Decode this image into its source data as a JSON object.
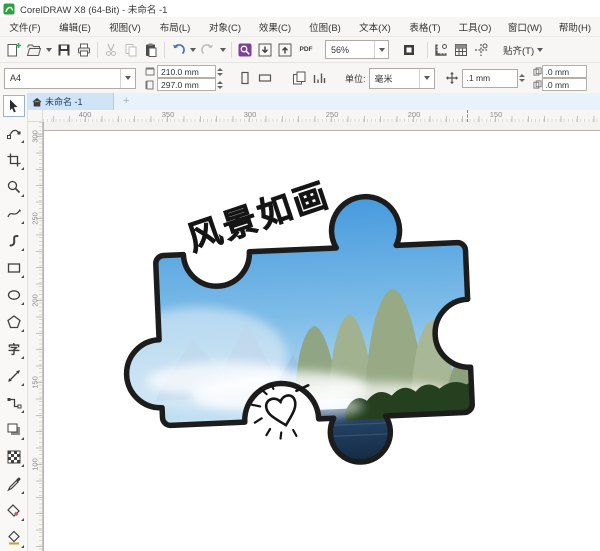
{
  "titlebar": {
    "title": "CorelDRAW X8 (64-Bit) - 未命名 -1"
  },
  "menubar": {
    "items": [
      "文件(F)",
      "编辑(E)",
      "视图(V)",
      "布局(L)",
      "对象(C)",
      "效果(C)",
      "位图(B)",
      "文本(X)",
      "表格(T)",
      "工具(O)",
      "窗口(W)",
      "帮助(H)"
    ]
  },
  "toolbar": {
    "zoom_level": "56%",
    "pdf_label": "PDF",
    "snap_label": "贴齐(T)",
    "icons": [
      "new-document",
      "open",
      "save",
      "print",
      "cut",
      "copy",
      "paste",
      "undo",
      "redo",
      "search-content",
      "import",
      "export",
      "publish-pdf",
      "fullscreen-preview",
      "show-rulers",
      "show-grid",
      "show-guidelines"
    ]
  },
  "property_bar": {
    "page_preset": "A4",
    "page_width": "210.0 mm",
    "page_height": "297.0 mm",
    "units_label": "单位:",
    "units_value": "毫米",
    "nudge_distance": ".1 mm",
    "duplicate_x": ".0 mm",
    "duplicate_y": ".0 mm"
  },
  "document_tab": {
    "label": "未命名 -1",
    "new_page_label": "+"
  },
  "rulers": {
    "horizontal": [
      "400",
      "350",
      "300",
      "250",
      "200",
      "150"
    ],
    "vertical": [
      "300",
      "250",
      "200",
      "150",
      "100"
    ]
  },
  "toolbox": {
    "text_tool_glyph": "字",
    "tools": [
      "选择工具",
      "形状工具",
      "裁剪工具",
      "缩放工具",
      "手绘工具",
      "艺术笔工具",
      "矩形工具",
      "椭圆形工具",
      "多边形工具",
      "文本工具",
      "平行度量工具",
      "连接器工具",
      "阴影工具",
      "透明度工具",
      "颜色滴管工具",
      "交互式填充工具",
      "智能填充工具"
    ]
  },
  "canvas": {
    "artwork_title": "风景如画"
  },
  "colors": {
    "accent_purple": "#7d3f98",
    "tab_blue": "#cfe4f6",
    "sky_top": "#3e95dc",
    "sky_bottom": "#ddeef8",
    "mountain": "#98ab86",
    "trees": "#24401e",
    "water": "#1b3147",
    "outline": "#1c1c1c",
    "logo_green": "#2ea043"
  }
}
